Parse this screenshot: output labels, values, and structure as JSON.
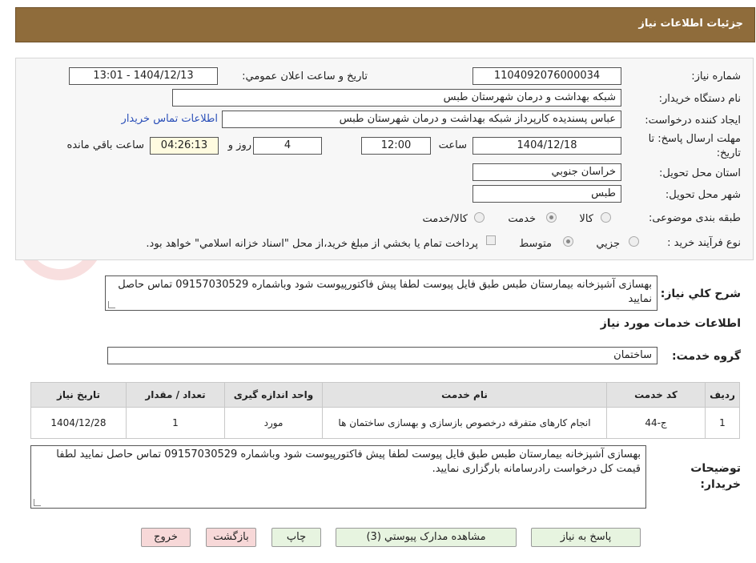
{
  "header": {
    "title": "جزئيات اطلاعات نياز"
  },
  "fields": {
    "need_number_label": "شماره نياز:",
    "need_number": "1104092076000034",
    "announce_label": "تاريخ و ساعت اعلان عمومي:",
    "announce_value": "1404/12/13 - 13:01",
    "buyer_org_label": "نام دستگاه خريدار:",
    "buyer_org": "شبکه بهداشت و درمان شهرستان طبس",
    "requester_label": "ايجاد کننده درخواست:",
    "requester": "عباس پسنديده کارپرداز شبکه بهداشت و درمان شهرستان طبس",
    "contact_link": "اطلاعات تماس خريدار",
    "deadline_label_1": "مهلت ارسال پاسخ: تا",
    "deadline_label_2": "تاريخ:",
    "deadline_date": "1404/12/18",
    "time_label": "ساعت",
    "deadline_time": "12:00",
    "days_value": "4",
    "days_label": "روز و",
    "remaining_time": "04:26:13",
    "remaining_label": "ساعت باقي مانده",
    "province_label": "استان محل تحويل:",
    "province": "خراسان جنوبي",
    "city_label": "شهر محل تحويل:",
    "city": "طبس",
    "category_label": "طبقه بندی موضوعی:",
    "category_options": [
      "کالا",
      "خدمت",
      "کالا/خدمت"
    ],
    "process_label": "نوع فرآيند خريد :",
    "process_options": [
      "جزيي",
      "متوسط"
    ],
    "payment_note": "پرداخت تمام يا بخشي از مبلغ خريد،از محل \"اسناد خزانه اسلامي\" خواهد بود."
  },
  "description": {
    "label": "شرح کلي نياز:",
    "text": "بهسازی آشپزخانه بیمارستان طبس طبق فایل پیوست لطفا پیش فاکتورپیوست شود وباشماره 09157030529 تماس حاصل نمایید"
  },
  "services": {
    "section_title": "اطلاعات خدمات مورد نياز",
    "group_label": "گروه خدمت:",
    "group_value": "ساختمان",
    "columns": [
      "رديف",
      "کد خدمت",
      "نام خدمت",
      "واحد اندازه گيری",
      "تعداد / مقدار",
      "تاريخ نياز"
    ],
    "rows": [
      [
        "1",
        "ج-44",
        "انجام کارهای متفرقه درخصوص بازسازی و بهسازی ساختمان ها",
        "مورد",
        "1",
        "1404/12/28"
      ]
    ]
  },
  "buyer_notes": {
    "label_1": "توضيحات",
    "label_2": "خريدار:",
    "text": "بهسازی آشپزخانه بیمارستان طبس طبق فایل پیوست لطفا پیش فاکتورپیوست شود وباشماره 09157030529 تماس حاصل نمایید لطفا قیمت کل درخواست رادرسامانه بارگزاری نمایید."
  },
  "buttons": {
    "reply": "پاسخ به نياز",
    "attachments": "مشاهده مدارک پيوستي (3)",
    "print": "چاپ",
    "back": "بازگشت",
    "exit": "خروج"
  },
  "colors": {
    "header_bg": "#8f6c3b",
    "link": "#2a4fb8",
    "green_button": "#e7f4e0",
    "red_button": "#f7d8d8"
  }
}
